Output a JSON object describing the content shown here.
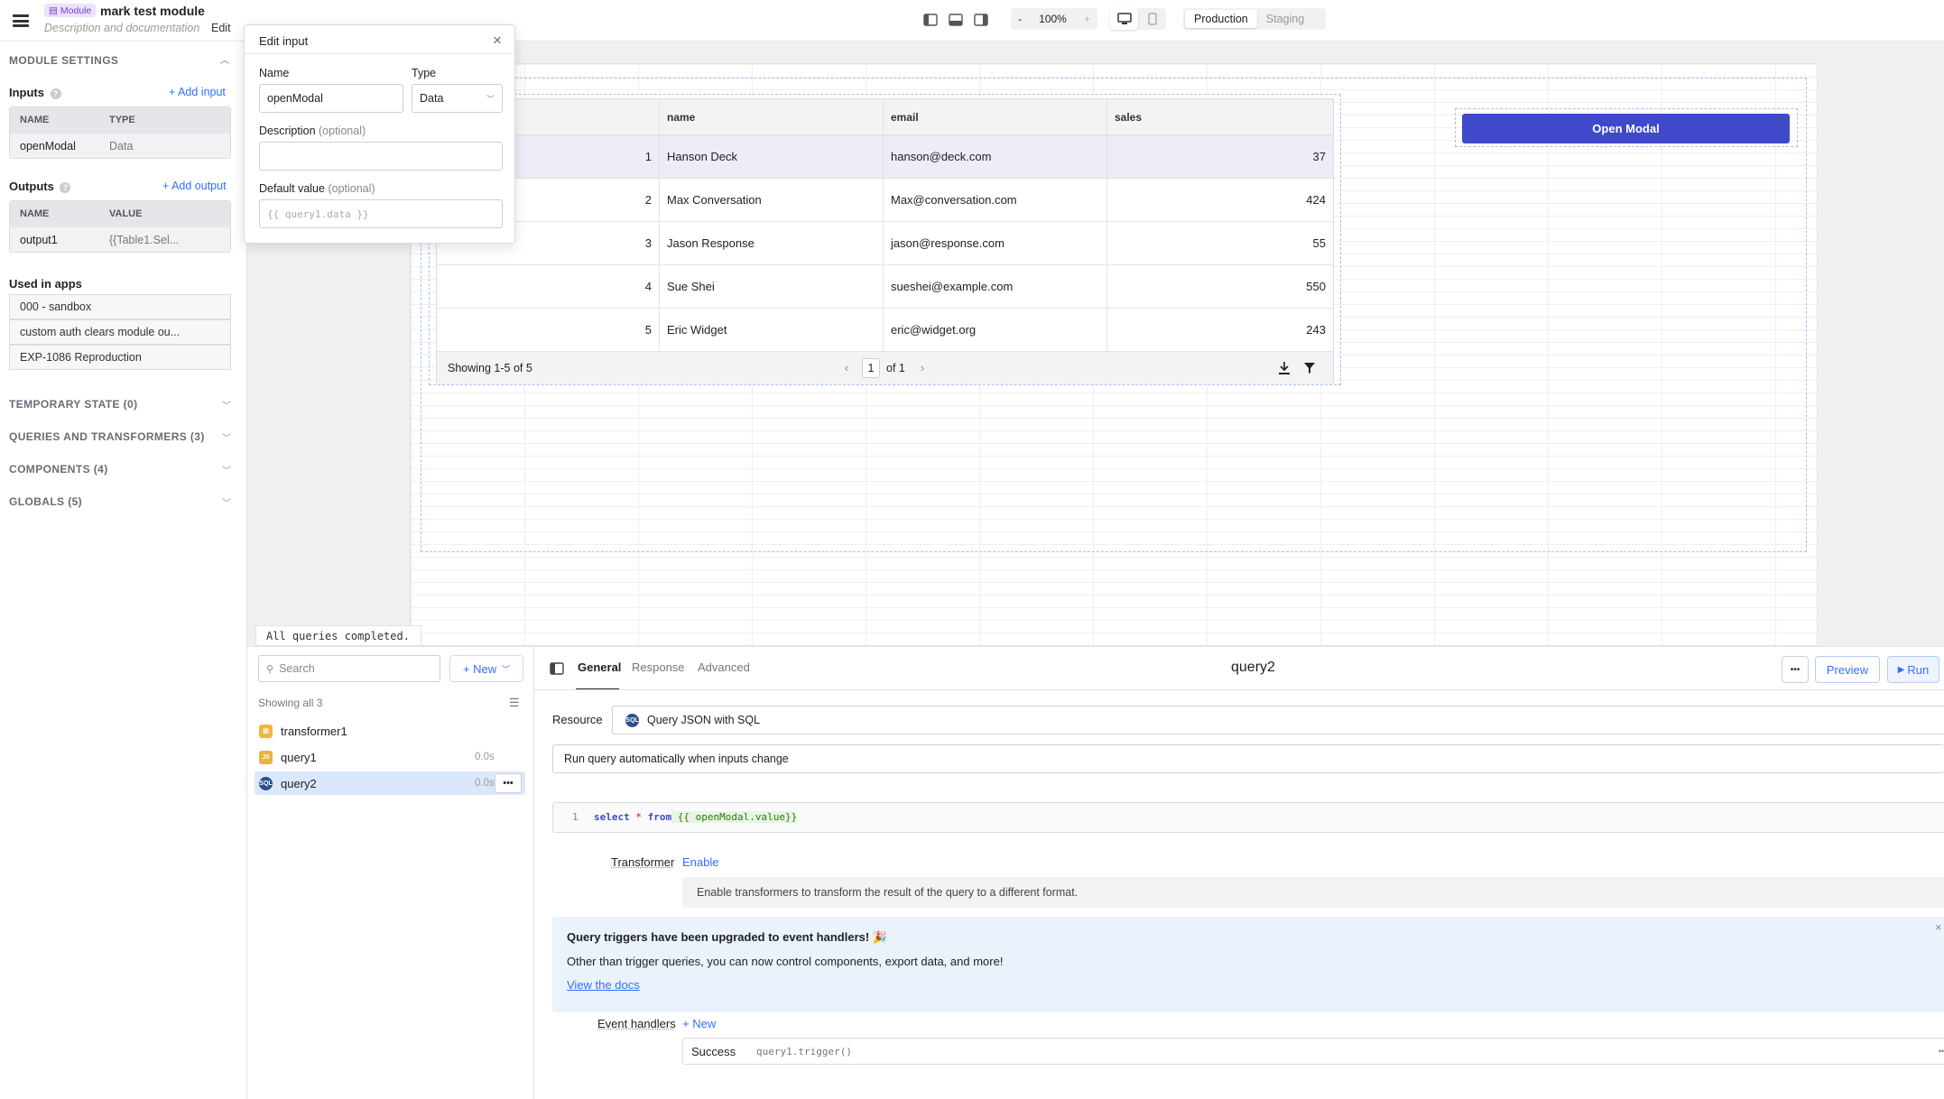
{
  "topbar": {
    "module_badge": "Module",
    "title": "mark test module",
    "subtitle": "Description and documentation",
    "edit": "Edit",
    "zoom_minus": "-",
    "zoom": "100%",
    "zoom_plus": "+",
    "env_production": "Production",
    "env_staging": "Staging"
  },
  "sidebar": {
    "module_settings": "MODULE SETTINGS",
    "inputs_label": "Inputs",
    "add_input": "+ Add input",
    "inputs_headers": [
      "NAME",
      "TYPE"
    ],
    "inputs_rows": [
      {
        "name": "openModal",
        "type": "Data"
      }
    ],
    "outputs_label": "Outputs",
    "add_output": "+ Add output",
    "outputs_headers": [
      "NAME",
      "VALUE"
    ],
    "outputs_rows": [
      {
        "name": "output1",
        "value": "{{Table1.Sel..."
      }
    ],
    "used_in_apps": "Used in apps",
    "apps": [
      "000 - sandbox",
      "custom auth clears module ou...",
      "EXP-1086 Reproduction"
    ],
    "sections": [
      "TEMPORARY STATE (0)",
      "QUERIES AND TRANSFORMERS (3)",
      "COMPONENTS (4)",
      "GLOBALS (5)"
    ]
  },
  "edit_input": {
    "title": "Edit input",
    "name_label": "Name",
    "name_value": "openModal",
    "type_label": "Type",
    "type_value": "Data",
    "description_label": "Description",
    "optional": "(optional)",
    "default_label": "Default value",
    "default_placeholder": "{{ query1.data }}"
  },
  "table": {
    "headers": [
      "",
      "name",
      "email",
      "sales"
    ],
    "rows": [
      {
        "id": "1",
        "name": "Hanson Deck",
        "email": "hanson@deck.com",
        "sales": "37"
      },
      {
        "id": "2",
        "name": "Max Conversation",
        "email": "Max@conversation.com",
        "sales": "424"
      },
      {
        "id": "3",
        "name": "Jason Response",
        "email": "jason@response.com",
        "sales": "55"
      },
      {
        "id": "4",
        "name": "Sue Shei",
        "email": "sueshei@example.com",
        "sales": "550"
      },
      {
        "id": "5",
        "name": "Eric Widget",
        "email": "eric@widget.org",
        "sales": "243"
      }
    ],
    "showing": "Showing 1-5 of 5",
    "page": "1",
    "of_pages": "of 1"
  },
  "open_modal_button": "Open Modal",
  "status_text": "All queries completed.",
  "query_list": {
    "search_placeholder": "Search",
    "new_button": "+ New",
    "showing": "Showing all 3",
    "items": [
      {
        "name": "transformer1",
        "time": "",
        "badge": "",
        "color": "#f5b63c"
      },
      {
        "name": "query1",
        "time": "0.0s",
        "badge": "JS",
        "color": "#e8b43a"
      },
      {
        "name": "query2",
        "time": "0.0s",
        "badge": "SQL",
        "color": "#2b4f8c"
      }
    ]
  },
  "query_editor": {
    "tabs": [
      "General",
      "Response",
      "Advanced"
    ],
    "title": "query2",
    "preview": "Preview",
    "run": "Run",
    "resource_label": "Resource",
    "resource_value": "Query JSON with SQL",
    "run_mode": "Run query automatically when inputs change",
    "line_no": "1",
    "code_kw1": "select",
    "code_star": " * ",
    "code_kw2": "from",
    "code_expr": " {{ openModal.value}}",
    "transformer_label": "Transformer",
    "transformer_enable": "Enable",
    "transformer_desc": "Enable transformers to transform the result of the query to a different format.",
    "banner_title": "Query triggers have been upgraded to event handlers! 🎉",
    "banner_text": "Other than trigger queries, you can now control components, export data, and more!",
    "banner_link": "View the docs",
    "event_handlers_label": "Event handlers",
    "event_new": "+ New",
    "event_type": "Success",
    "event_action": "query1.trigger()"
  }
}
